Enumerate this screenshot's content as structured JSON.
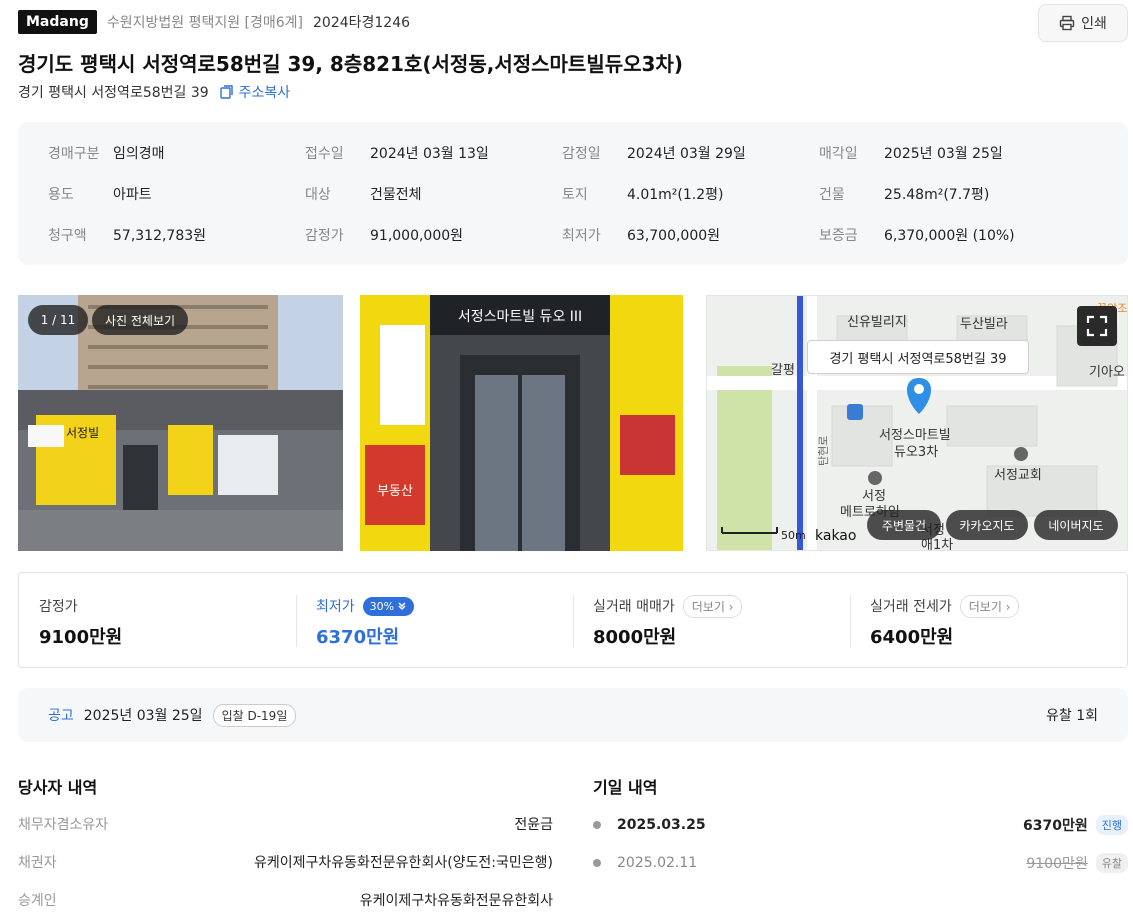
{
  "header": {
    "brand": "Madang",
    "court": "수원지방법원 평택지원 [경매6계]",
    "case_no": "2024타경1246",
    "print_label": "인쇄"
  },
  "title": "경기도 평택시 서정역로58번길 39, 8층821호(서정동,서정스마트빌듀오3차)",
  "sub_address": "경기 평택시 서정역로58번길 39",
  "copy_label": "주소복사",
  "info": [
    {
      "label": "경매구분",
      "value": "임의경매"
    },
    {
      "label": "접수일",
      "value": "2024년 03월 13일"
    },
    {
      "label": "감정일",
      "value": "2024년 03월 29일"
    },
    {
      "label": "매각일",
      "value": "2025년 03월 25일"
    },
    {
      "label": "용도",
      "value": "아파트"
    },
    {
      "label": "대상",
      "value": "건물전체"
    },
    {
      "label": "토지",
      "value": "4.01m²(1.2평)"
    },
    {
      "label": "건물",
      "value": "25.48m²(7.7평)"
    },
    {
      "label": "청구액",
      "value": "57,312,783원"
    },
    {
      "label": "감정가",
      "value": "91,000,000원"
    },
    {
      "label": "최저가",
      "value": "63,700,000원"
    },
    {
      "label": "보증금",
      "value": "6,370,000원 (10%)"
    }
  ],
  "photos": {
    "counter": "1 / 11",
    "view_all": "사진 전체보기",
    "photo1_sign": "서정빌",
    "photo2_sign": "서정스마트빌 듀오 III",
    "photo2_shop": "부동산"
  },
  "map": {
    "address_tip": "경기 평택시 서정역로58번길 39",
    "labels": [
      "신유빌리지",
      "두산빌라",
      "갈평",
      "기아오",
      "서정스마트빌",
      "듀오3차",
      "서정교회",
      "서정",
      "메트로하임",
      "서정",
      "애1차",
      "탄현로",
      "꽃앙조"
    ],
    "scale": "50m",
    "provider": "kakao",
    "btn_nearby": "주변물건",
    "btn_kakao": "카카오지도",
    "btn_naver": "네이버지도"
  },
  "prices": {
    "appraisal_label": "감정가",
    "appraisal_value": "9100만원",
    "min_label": "최저가",
    "min_badge": "30%",
    "min_value": "6370만원",
    "sale_label": "실거래 매매가",
    "sale_more": "더보기",
    "sale_value": "8000만원",
    "jeonse_label": "실거래 전세가",
    "jeonse_more": "더보기",
    "jeonse_value": "6400만원"
  },
  "notice": {
    "label": "공고",
    "date": "2025년 03월 25일",
    "dday": "입찰 D-19일",
    "fail_count": "유찰 1회"
  },
  "parties": {
    "title": "당사자 내역",
    "rows": [
      {
        "label": "채무자겸소유자",
        "value": "전윤금"
      },
      {
        "label": "채권자",
        "value": "유케이제구차유동화전문유한회사(양도전:국민은행)"
      },
      {
        "label": "승계인",
        "value": "유케이제구차유동화전문유한회사"
      }
    ]
  },
  "schedule": {
    "title": "기일 내역",
    "rows": [
      {
        "date": "2025.03.25",
        "amount": "6370만원",
        "status": "진행"
      },
      {
        "date": "2025.02.11",
        "amount": "9100만원",
        "status": "유찰"
      }
    ]
  },
  "colors": {
    "accent": "#2f6fdc",
    "marker": "#2f8fe8"
  }
}
